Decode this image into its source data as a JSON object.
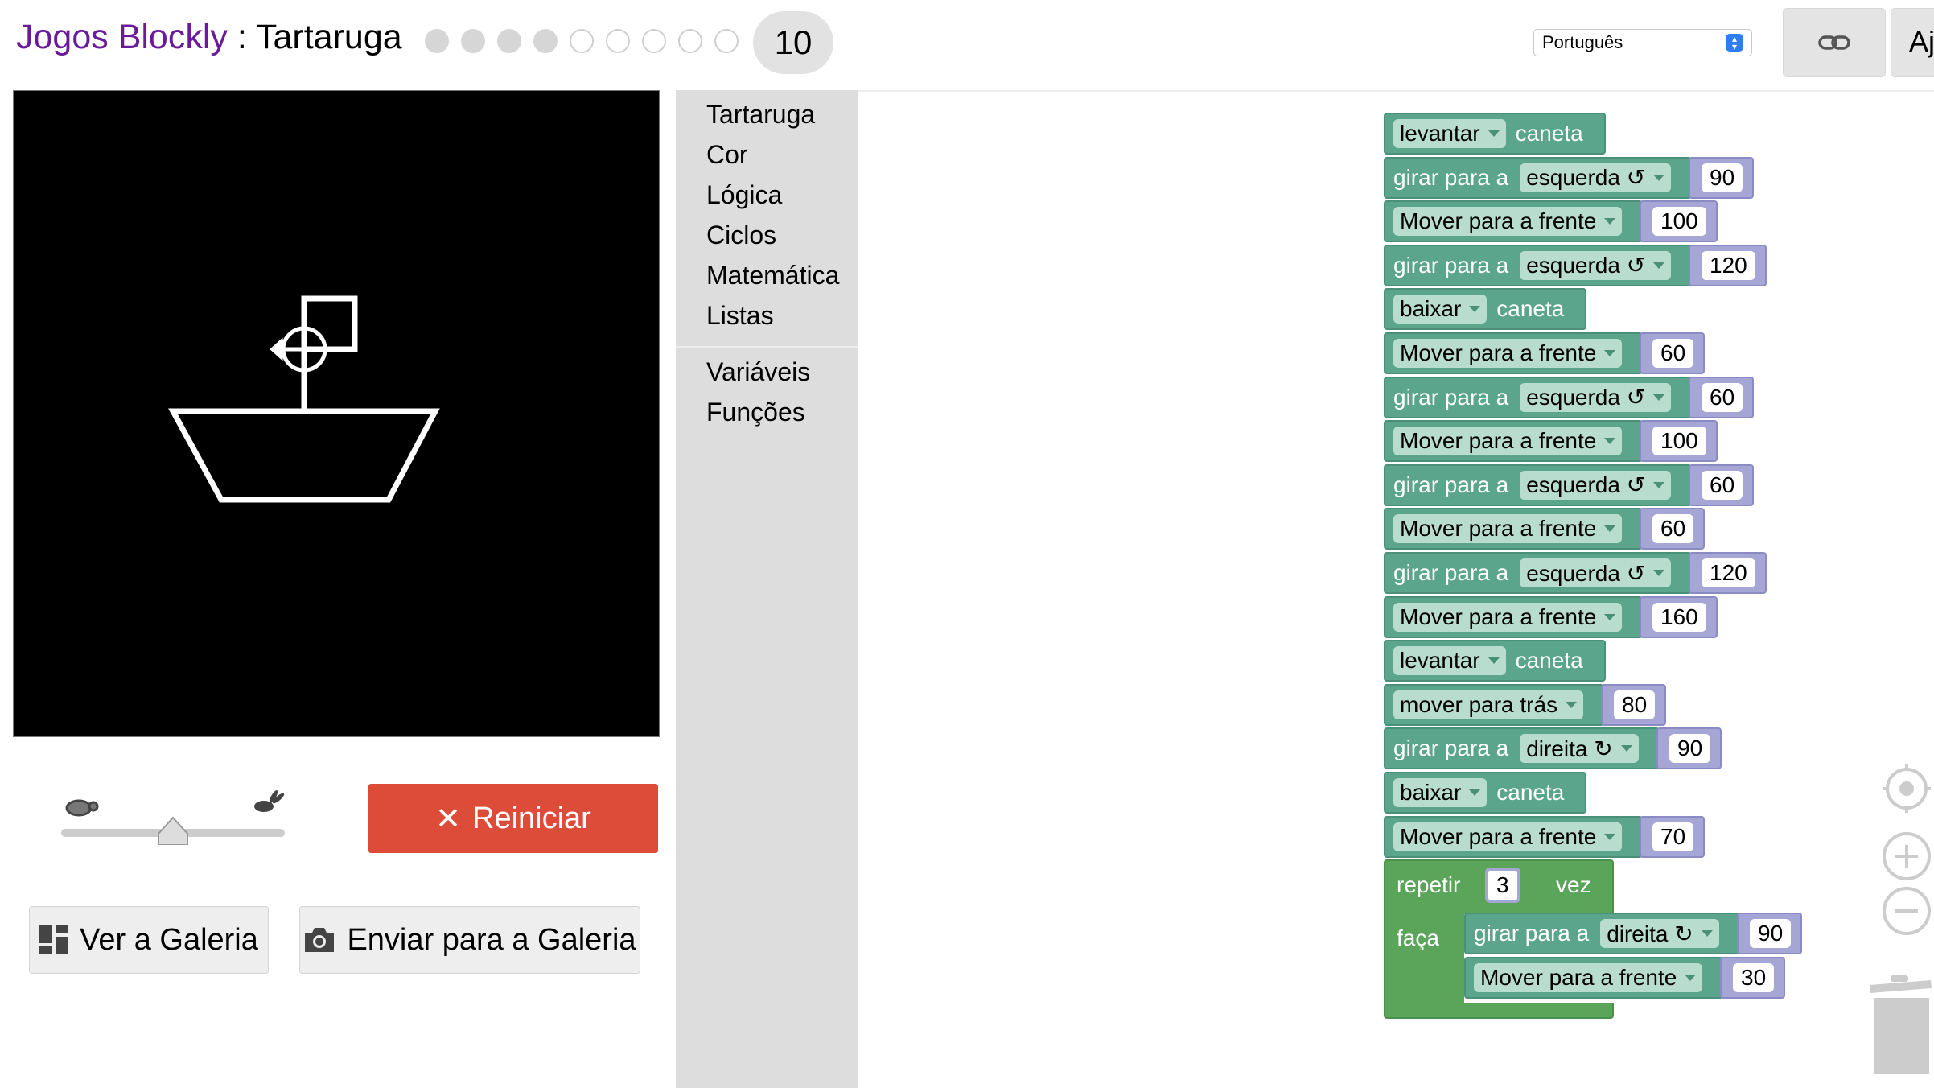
{
  "header": {
    "brand": "Jogos Blockly",
    "separator": " : ",
    "app_name": "Tartaruga",
    "levels": [
      {
        "n": 1,
        "done": true
      },
      {
        "n": 2,
        "done": true
      },
      {
        "n": 3,
        "done": true
      },
      {
        "n": 4,
        "done": true
      },
      {
        "n": 5,
        "done": false
      },
      {
        "n": 6,
        "done": false
      },
      {
        "n": 7,
        "done": false
      },
      {
        "n": 8,
        "done": false
      },
      {
        "n": 9,
        "done": false
      }
    ],
    "current_level": "10",
    "language": "Português",
    "help_label": "Aj",
    "link_icon": "link-icon"
  },
  "controls": {
    "speed_value": 0.5,
    "reset_label": "Reiniciar",
    "gallery_label": "Ver a Galeria",
    "submit_label": "Enviar para a Galeria"
  },
  "toolbox": {
    "items": [
      "Tartaruga",
      "Cor",
      "Lógica",
      "Ciclos",
      "Matemática",
      "Listas"
    ],
    "items2": [
      "Variáveis",
      "Funções"
    ]
  },
  "blocks": [
    {
      "kind": "pen",
      "dd": "levantar",
      "label": "caneta"
    },
    {
      "kind": "turn",
      "label": "girar para a",
      "dd": "esquerda ↺",
      "value": "90"
    },
    {
      "kind": "move",
      "dd": "Mover para a frente",
      "value": "100"
    },
    {
      "kind": "turn",
      "label": "girar para a",
      "dd": "esquerda ↺",
      "value": "120"
    },
    {
      "kind": "pen",
      "dd": "baixar",
      "label": "caneta"
    },
    {
      "kind": "move",
      "dd": "Mover para a frente",
      "value": "60"
    },
    {
      "kind": "turn",
      "label": "girar para a",
      "dd": "esquerda ↺",
      "value": "60"
    },
    {
      "kind": "move",
      "dd": "Mover para a frente",
      "value": "100"
    },
    {
      "kind": "turn",
      "label": "girar para a",
      "dd": "esquerda ↺",
      "value": "60"
    },
    {
      "kind": "move",
      "dd": "Mover para a frente",
      "value": "60"
    },
    {
      "kind": "turn",
      "label": "girar para a",
      "dd": "esquerda ↺",
      "value": "120"
    },
    {
      "kind": "move",
      "dd": "Mover para a frente",
      "value": "160"
    },
    {
      "kind": "pen",
      "dd": "levantar",
      "label": "caneta"
    },
    {
      "kind": "move",
      "dd": "mover para trás",
      "value": "80"
    },
    {
      "kind": "turn",
      "label": "girar para a",
      "dd": "direita ↻",
      "value": "90"
    },
    {
      "kind": "pen",
      "dd": "baixar",
      "label": "caneta"
    },
    {
      "kind": "move",
      "dd": "Mover para a frente",
      "value": "70"
    }
  ],
  "repeat": {
    "label": "repetir",
    "count": "3",
    "suffix": "vez",
    "do_label": "faça",
    "body": [
      {
        "kind": "turn",
        "label": "girar para a",
        "dd": "direita ↻",
        "value": "90"
      },
      {
        "kind": "move",
        "dd": "Mover para a frente",
        "value": "30"
      }
    ]
  }
}
